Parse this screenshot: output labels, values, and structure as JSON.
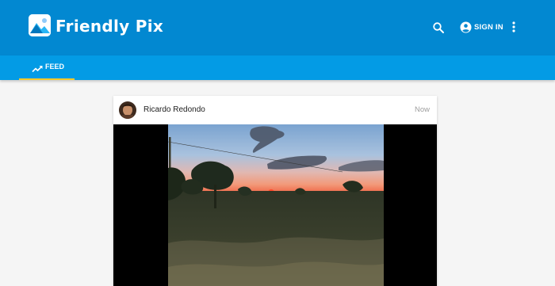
{
  "app": {
    "title": "Friendly Pix"
  },
  "header": {
    "signin_label": "SIGN IN",
    "icons": [
      "search-icon",
      "account-circle-icon",
      "more-vert-icon"
    ]
  },
  "tabs": [
    {
      "label": "FEED",
      "icon": "trending-up-icon",
      "active": true
    }
  ],
  "post": {
    "author": "Ricardo Redondo",
    "timestamp": "Now"
  },
  "colors": {
    "appbar": "#0288d1",
    "tabbar": "#039be5",
    "tab_indicator": "#ffca28",
    "background": "#f5f5f5"
  }
}
